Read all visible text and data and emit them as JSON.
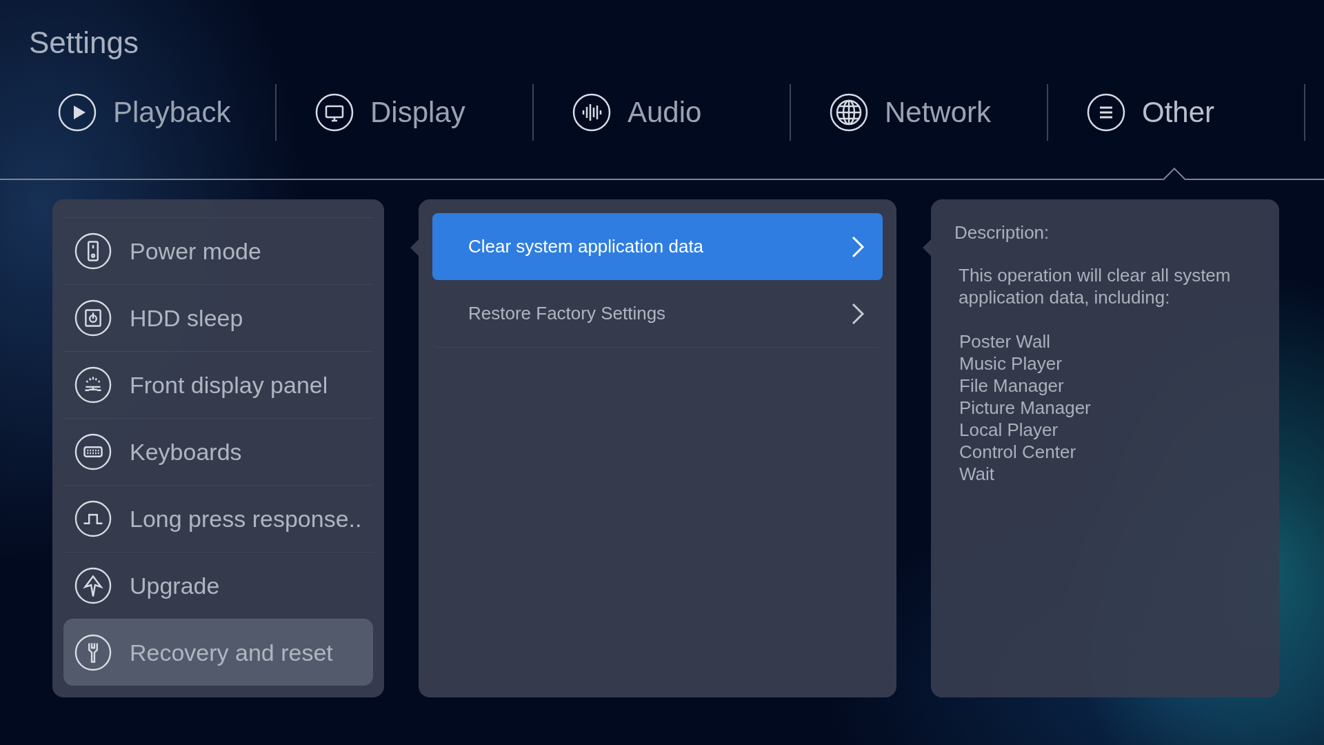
{
  "title": "Settings",
  "tabs": [
    {
      "label": "Playback",
      "selected": false
    },
    {
      "label": "Display",
      "selected": false
    },
    {
      "label": "Audio",
      "selected": false
    },
    {
      "label": "Network",
      "selected": false
    },
    {
      "label": "Other",
      "selected": true
    }
  ],
  "menu": [
    {
      "label": "Power mode",
      "selected": false
    },
    {
      "label": "HDD sleep",
      "selected": false
    },
    {
      "label": "Front display panel",
      "selected": false
    },
    {
      "label": "Keyboards",
      "selected": false
    },
    {
      "label": "Long press response..",
      "selected": false
    },
    {
      "label": "Upgrade",
      "selected": false
    },
    {
      "label": "Recovery and reset",
      "selected": true
    }
  ],
  "options": [
    {
      "label": "Clear system application data",
      "selected": true
    },
    {
      "label": "Restore Factory Settings",
      "selected": false
    }
  ],
  "description": {
    "heading": "Description:",
    "text": "This operation will clear all system application data, including:",
    "items": [
      "Poster Wall",
      "Music Player",
      "File Manager",
      "Picture Manager",
      "Local Player",
      "Control Center",
      "Wait"
    ]
  }
}
